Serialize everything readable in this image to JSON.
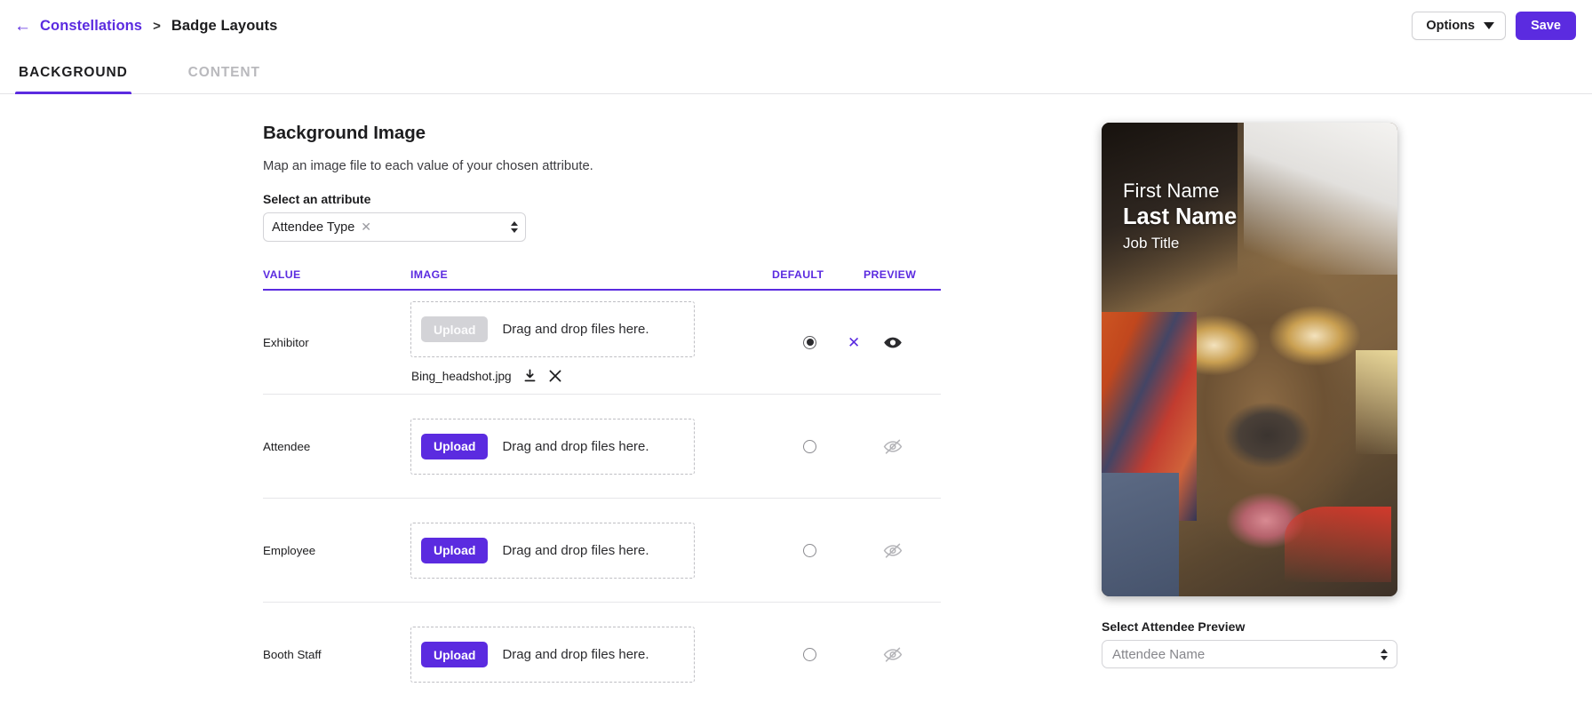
{
  "header": {
    "back_icon": "arrow-left-icon",
    "breadcrumb_parent": "Constellations",
    "breadcrumb_separator": ">",
    "breadcrumb_current": "Badge Layouts",
    "options_label": "Options",
    "options_caret_icon": "caret-down-icon",
    "save_label": "Save",
    "accent_color": "#5b2be0"
  },
  "tabs": [
    {
      "label": "BACKGROUND",
      "active": true
    },
    {
      "label": "CONTENT",
      "active": false
    }
  ],
  "main": {
    "title": "Background Image",
    "subtitle": "Map an image file to each value of your chosen attribute.",
    "attribute_field_label": "Select an attribute",
    "attribute_chip": "Attendee Type",
    "attribute_chip_remove_icon": "close-icon",
    "attribute_stepper_icon": "stepper-updown-icon"
  },
  "table": {
    "columns": [
      "VALUE",
      "IMAGE",
      "DEFAULT",
      "PREVIEW"
    ],
    "dropzone_text": "Drag and drop files here.",
    "upload_label": "Upload",
    "rows": [
      {
        "value": "Exhibitor",
        "upload_label": "Upload",
        "upload_disabled": true,
        "dropzone_text": "Drag and drop files here.",
        "filename": "Bing_headshot.jpg",
        "download_icon": "download-icon",
        "remove_icon": "close-icon",
        "default_selected": true,
        "clear_default_icon": "x-icon",
        "preview_icon": "eye-icon",
        "preview_enabled": true
      },
      {
        "value": "Attendee",
        "upload_label": "Upload",
        "upload_disabled": false,
        "dropzone_text": "Drag and drop files here.",
        "filename": "",
        "default_selected": false,
        "preview_icon": "eye-off-icon",
        "preview_enabled": false
      },
      {
        "value": "Employee",
        "upload_label": "Upload",
        "upload_disabled": false,
        "dropzone_text": "Drag and drop files here.",
        "filename": "",
        "default_selected": false,
        "preview_icon": "eye-off-icon",
        "preview_enabled": false
      },
      {
        "value": "Booth Staff",
        "upload_label": "Upload",
        "upload_disabled": false,
        "dropzone_text": "Drag and drop files here.",
        "filename": "",
        "default_selected": false,
        "preview_icon": "eye-off-icon",
        "preview_enabled": false
      }
    ]
  },
  "preview": {
    "badge": {
      "first_name": "First Name",
      "last_name": "Last Name",
      "job_title": "Job Title",
      "background_image": "photo of a dog close-up"
    },
    "select_label": "Select Attendee Preview",
    "select_placeholder": "Attendee Name",
    "select_stepper_icon": "stepper-updown-icon"
  }
}
